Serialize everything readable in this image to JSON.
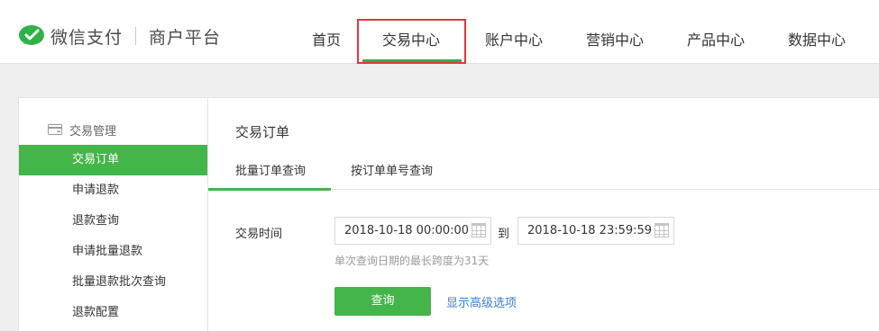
{
  "header": {
    "brand": "微信支付",
    "product": "商户平台",
    "brand_color": "#2fb148",
    "nav": [
      {
        "label": "首页"
      },
      {
        "label": "交易中心",
        "active": true
      },
      {
        "label": "账户中心"
      },
      {
        "label": "营销中心"
      },
      {
        "label": "产品中心"
      },
      {
        "label": "数据中心"
      }
    ],
    "highlight_color": "#e0383e"
  },
  "sidebar": {
    "group_label": "交易管理",
    "group_icon": "card-icon",
    "items": [
      {
        "label": "交易订单",
        "active": true
      },
      {
        "label": "申请退款"
      },
      {
        "label": "退款查询"
      },
      {
        "label": "申请批量退款"
      },
      {
        "label": "批量退款批次查询"
      },
      {
        "label": "退款配置"
      }
    ],
    "accent_color": "#44b549"
  },
  "main": {
    "title": "交易订单",
    "tabs": [
      {
        "label": "批量订单查询",
        "active": true
      },
      {
        "label": "按订单单号查询"
      }
    ],
    "time_field": {
      "label": "交易时间",
      "start": "2018-10-18 00:00:00",
      "separator": "到",
      "end": "2018-10-18 23:59:59",
      "calendar_icon": "calendar-icon",
      "hint": "单次查询日期的最长跨度为31天"
    },
    "query_button": "查询",
    "advanced_link": "显示高级选项",
    "link_color": "#3a7bd5"
  }
}
